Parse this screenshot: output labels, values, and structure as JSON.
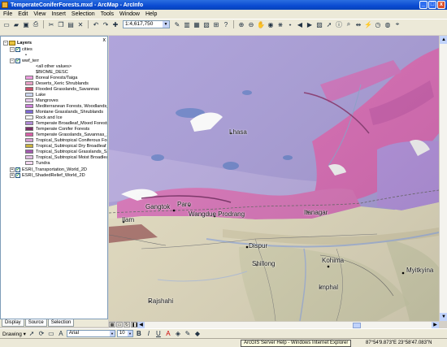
{
  "window": {
    "title": "TemperateConiferForests.mxd - ArcMap - ArcInfo",
    "minimize": "_",
    "maximize": "□",
    "close": "x"
  },
  "menu": [
    "File",
    "Edit",
    "View",
    "Insert",
    "Selection",
    "Tools",
    "Window",
    "Help"
  ],
  "toolbar": {
    "scale": "1:4,617,750"
  },
  "toc": {
    "close_label": "x",
    "root": "Layers",
    "layers": {
      "cities": "cities",
      "cities_symbol": "•",
      "wwf_terr": "wwf_terr",
      "all_other": "<all other values>",
      "field": "$BIOME_DESC",
      "transport": "ESRI_Transportation_World_2D",
      "shaded": "ESRI_ShadedRelief_World_2D"
    },
    "legend": [
      {
        "label": "Boreal Forests/Taiga",
        "color": "#ef9be0"
      },
      {
        "label": "Deserts_Xeric Shrublands",
        "color": "#e8a2c8"
      },
      {
        "label": "Flooded Grasslands_Savannas",
        "color": "#c9506e"
      },
      {
        "label": "Lake",
        "color": "#cdd8f2"
      },
      {
        "label": "Mangroves",
        "color": "#e7c8ec"
      },
      {
        "label": "Mediterranean Forests, Woodlands_Scrub",
        "color": "#cc7fd9"
      },
      {
        "label": "Montane Grasslands_Shrublands",
        "color": "#7d6ad4"
      },
      {
        "label": "Rock and Ice",
        "color": "#ffffff"
      },
      {
        "label": "Temperate Broadleaf_Mixed Forests",
        "color": "#b08ad6"
      },
      {
        "label": "Temperate Conifer Forests",
        "color": "#7a2f66"
      },
      {
        "label": "Temperate Grasslands_Savannas_Shrubland",
        "color": "#d85fa7"
      },
      {
        "label": "Tropical_Subtropical Coniferous Forests",
        "color": "#d6a0d2"
      },
      {
        "label": "Tropical_Subtropical Dry Broadleaf Forests",
        "color": "#c9b23e"
      },
      {
        "label": "Tropical_Subtropical Grasslands_Savannas_Sh",
        "color": "#a35ab0"
      },
      {
        "label": "Tropical_Subtropical Moist Broadleaf Forests",
        "color": "#e3c0e6"
      },
      {
        "label": "Tundra",
        "color": "#f4d6f0"
      }
    ],
    "tabs": [
      "Display",
      "Source",
      "Selection"
    ]
  },
  "map": {
    "labels": [
      {
        "text": "Lhasa"
      },
      {
        "text": "Gangtok"
      },
      {
        "text": "Paro"
      },
      {
        "text": "Ilam"
      },
      {
        "text": "Wangdue Prodrang"
      },
      {
        "text": "Itanagar"
      },
      {
        "text": "Dispur"
      },
      {
        "text": "Shillong"
      },
      {
        "text": "Kohima"
      },
      {
        "text": "Myitkyina"
      },
      {
        "text": "Imphal"
      },
      {
        "text": "Rajshahi"
      }
    ]
  },
  "drawing": {
    "label": "Drawing ▾",
    "font": "Arial",
    "size": "10",
    "bold": "B",
    "italic": "I",
    "underline": "U"
  },
  "status": {
    "tooltip": "ArcGIS Server Help - Windows Internet Explorer",
    "coords": "87°54'9.873\"E  23°58'47.083\"N"
  }
}
